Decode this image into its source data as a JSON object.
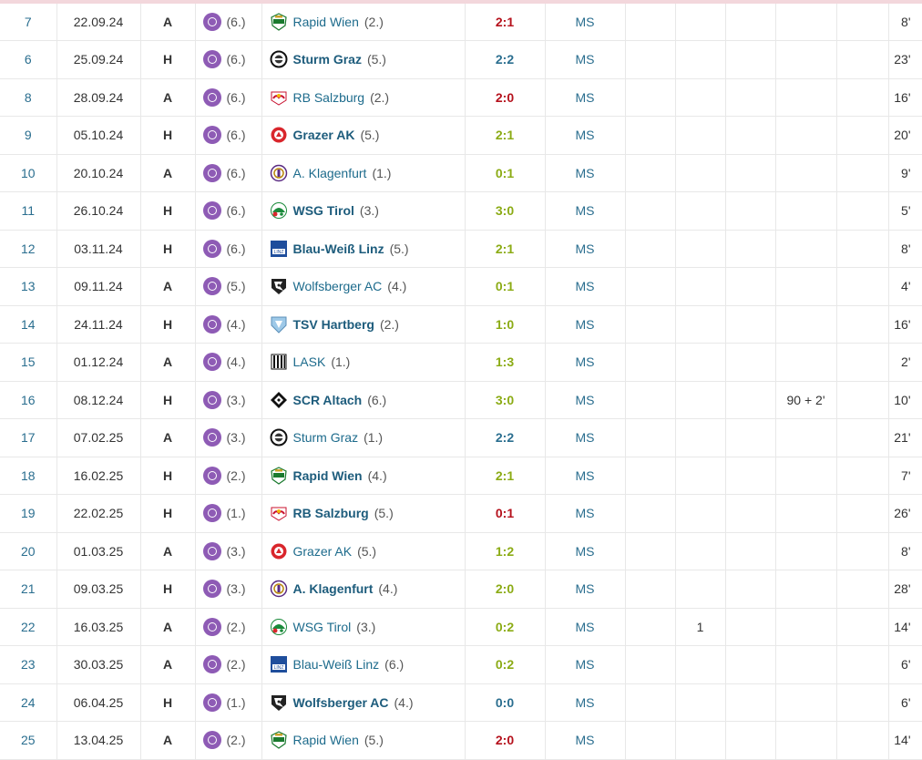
{
  "colors": {
    "win": "#8bab14",
    "loss": "#b5111c",
    "draw": "#2a6e8f",
    "link": "#1d6b8c"
  },
  "rows": [
    {
      "md": "7",
      "date": "22.09.24",
      "ha": "A",
      "own_rank": "(6.)",
      "opp": "Rapid Wien",
      "opp_rank": "(2.)",
      "crest": "rapid-wien-crest",
      "result": "2:1",
      "outcome": "loss",
      "comp": "MS",
      "extra_a": "",
      "extra_b": "",
      "minute": "",
      "mins": "8'"
    },
    {
      "md": "6",
      "date": "25.09.24",
      "ha": "H",
      "own_rank": "(6.)",
      "opp": "Sturm Graz",
      "opp_rank": "(5.)",
      "crest": "sturm-graz-crest",
      "result": "2:2",
      "outcome": "draw",
      "comp": "MS",
      "extra_a": "",
      "extra_b": "",
      "minute": "",
      "mins": "23'"
    },
    {
      "md": "8",
      "date": "28.09.24",
      "ha": "A",
      "own_rank": "(6.)",
      "opp": "RB Salzburg",
      "opp_rank": "(2.)",
      "crest": "rb-salzburg-crest",
      "result": "2:0",
      "outcome": "loss",
      "comp": "MS",
      "extra_a": "",
      "extra_b": "",
      "minute": "",
      "mins": "16'"
    },
    {
      "md": "9",
      "date": "05.10.24",
      "ha": "H",
      "own_rank": "(6.)",
      "opp": "Grazer AK",
      "opp_rank": "(5.)",
      "crest": "grazer-ak-crest",
      "result": "2:1",
      "outcome": "win",
      "comp": "MS",
      "extra_a": "",
      "extra_b": "",
      "minute": "",
      "mins": "20'"
    },
    {
      "md": "10",
      "date": "20.10.24",
      "ha": "A",
      "own_rank": "(6.)",
      "opp": "A. Klagenfurt",
      "opp_rank": "(1.)",
      "crest": "klagenfurt-crest",
      "result": "0:1",
      "outcome": "win",
      "comp": "MS",
      "extra_a": "",
      "extra_b": "",
      "minute": "",
      "mins": "9'"
    },
    {
      "md": "11",
      "date": "26.10.24",
      "ha": "H",
      "own_rank": "(6.)",
      "opp": "WSG Tirol",
      "opp_rank": "(3.)",
      "crest": "wsg-tirol-crest",
      "result": "3:0",
      "outcome": "win",
      "comp": "MS",
      "extra_a": "",
      "extra_b": "",
      "minute": "",
      "mins": "5'"
    },
    {
      "md": "12",
      "date": "03.11.24",
      "ha": "H",
      "own_rank": "(6.)",
      "opp": "Blau-Weiß Linz",
      "opp_rank": "(5.)",
      "crest": "blau-weiss-linz-crest",
      "result": "2:1",
      "outcome": "win",
      "comp": "MS",
      "extra_a": "",
      "extra_b": "",
      "minute": "",
      "mins": "8'"
    },
    {
      "md": "13",
      "date": "09.11.24",
      "ha": "A",
      "own_rank": "(5.)",
      "opp": "Wolfsberger AC",
      "opp_rank": "(4.)",
      "crest": "wolfsberger-ac-crest",
      "result": "0:1",
      "outcome": "win",
      "comp": "MS",
      "extra_a": "",
      "extra_b": "",
      "minute": "",
      "mins": "4'"
    },
    {
      "md": "14",
      "date": "24.11.24",
      "ha": "H",
      "own_rank": "(4.)",
      "opp": "TSV Hartberg",
      "opp_rank": "(2.)",
      "crest": "tsv-hartberg-crest",
      "result": "1:0",
      "outcome": "win",
      "comp": "MS",
      "extra_a": "",
      "extra_b": "",
      "minute": "",
      "mins": "16'"
    },
    {
      "md": "15",
      "date": "01.12.24",
      "ha": "A",
      "own_rank": "(4.)",
      "opp": "LASK",
      "opp_rank": "(1.)",
      "crest": "lask-crest",
      "result": "1:3",
      "outcome": "win",
      "comp": "MS",
      "extra_a": "",
      "extra_b": "",
      "minute": "",
      "mins": "2'"
    },
    {
      "md": "16",
      "date": "08.12.24",
      "ha": "H",
      "own_rank": "(3.)",
      "opp": "SCR Altach",
      "opp_rank": "(6.)",
      "crest": "scr-altach-crest",
      "result": "3:0",
      "outcome": "win",
      "comp": "MS",
      "extra_a": "",
      "extra_b": "",
      "minute": "90 + 2'",
      "mins": "10'"
    },
    {
      "md": "17",
      "date": "07.02.25",
      "ha": "A",
      "own_rank": "(3.)",
      "opp": "Sturm Graz",
      "opp_rank": "(1.)",
      "crest": "sturm-graz-crest",
      "result": "2:2",
      "outcome": "draw",
      "comp": "MS",
      "extra_a": "",
      "extra_b": "",
      "minute": "",
      "mins": "21'"
    },
    {
      "md": "18",
      "date": "16.02.25",
      "ha": "H",
      "own_rank": "(2.)",
      "opp": "Rapid Wien",
      "opp_rank": "(4.)",
      "crest": "rapid-wien-crest",
      "result": "2:1",
      "outcome": "win",
      "comp": "MS",
      "extra_a": "",
      "extra_b": "",
      "minute": "",
      "mins": "7'"
    },
    {
      "md": "19",
      "date": "22.02.25",
      "ha": "H",
      "own_rank": "(1.)",
      "opp": "RB Salzburg",
      "opp_rank": "(5.)",
      "crest": "rb-salzburg-crest",
      "result": "0:1",
      "outcome": "loss",
      "comp": "MS",
      "extra_a": "",
      "extra_b": "",
      "minute": "",
      "mins": "26'"
    },
    {
      "md": "20",
      "date": "01.03.25",
      "ha": "A",
      "own_rank": "(3.)",
      "opp": "Grazer AK",
      "opp_rank": "(5.)",
      "crest": "grazer-ak-crest",
      "result": "1:2",
      "outcome": "win",
      "comp": "MS",
      "extra_a": "",
      "extra_b": "",
      "minute": "",
      "mins": "8'"
    },
    {
      "md": "21",
      "date": "09.03.25",
      "ha": "H",
      "own_rank": "(3.)",
      "opp": "A. Klagenfurt",
      "opp_rank": "(4.)",
      "crest": "klagenfurt-crest",
      "result": "2:0",
      "outcome": "win",
      "comp": "MS",
      "extra_a": "",
      "extra_b": "",
      "minute": "",
      "mins": "28'"
    },
    {
      "md": "22",
      "date": "16.03.25",
      "ha": "A",
      "own_rank": "(2.)",
      "opp": "WSG Tirol",
      "opp_rank": "(3.)",
      "crest": "wsg-tirol-crest",
      "result": "0:2",
      "outcome": "win",
      "comp": "MS",
      "extra_a": "",
      "extra_b": "1",
      "minute": "",
      "mins": "14'"
    },
    {
      "md": "23",
      "date": "30.03.25",
      "ha": "A",
      "own_rank": "(2.)",
      "opp": "Blau-Weiß Linz",
      "opp_rank": "(6.)",
      "crest": "blau-weiss-linz-crest",
      "result": "0:2",
      "outcome": "win",
      "comp": "MS",
      "extra_a": "",
      "extra_b": "",
      "minute": "",
      "mins": "6'"
    },
    {
      "md": "24",
      "date": "06.04.25",
      "ha": "H",
      "own_rank": "(1.)",
      "opp": "Wolfsberger AC",
      "opp_rank": "(4.)",
      "crest": "wolfsberger-ac-crest",
      "result": "0:0",
      "outcome": "draw",
      "comp": "MS",
      "extra_a": "",
      "extra_b": "",
      "minute": "",
      "mins": "6'"
    },
    {
      "md": "25",
      "date": "13.04.25",
      "ha": "A",
      "own_rank": "(2.)",
      "opp": "Rapid Wien",
      "opp_rank": "(5.)",
      "crest": "rapid-wien-crest",
      "result": "2:0",
      "outcome": "loss",
      "comp": "MS",
      "extra_a": "",
      "extra_b": "",
      "minute": "",
      "mins": "14'"
    }
  ]
}
